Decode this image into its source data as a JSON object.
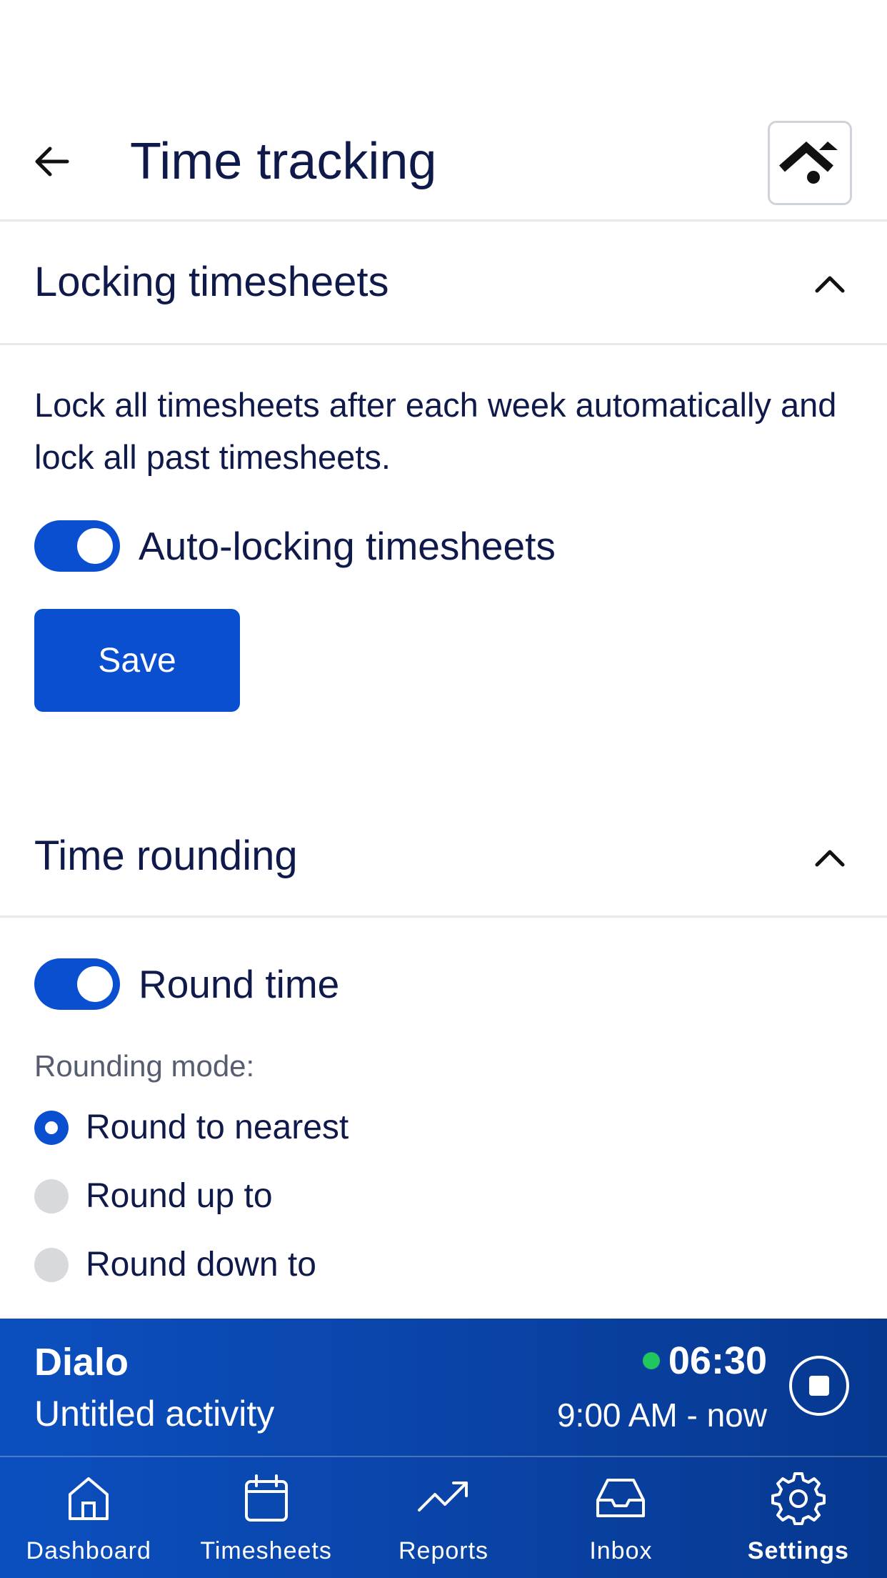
{
  "header": {
    "title": "Time tracking",
    "back_icon": "arrow-left-icon",
    "logo_icon": "roof-logo-icon"
  },
  "locking": {
    "title": "Locking timesheets",
    "description": "Lock all timesheets after each week automatically and lock all past timesheets.",
    "toggle_label": "Auto-locking timesheets",
    "toggle_on": true,
    "save_label": "Save"
  },
  "rounding": {
    "title": "Time rounding",
    "toggle_label": "Round time",
    "toggle_on": true,
    "mode_label": "Rounding mode:",
    "options": [
      {
        "label": "Round to nearest",
        "selected": true
      },
      {
        "label": "Round up to",
        "selected": false
      },
      {
        "label": "Round down to",
        "selected": false
      }
    ]
  },
  "timer": {
    "client": "Dialo",
    "activity": "Untitled activity",
    "elapsed": "06:30",
    "range": "9:00 AM - now",
    "status_color": "#22c55e"
  },
  "nav": {
    "items": [
      {
        "label": "Dashboard",
        "icon": "home-icon",
        "active": false
      },
      {
        "label": "Timesheets",
        "icon": "calendar-icon",
        "active": false
      },
      {
        "label": "Reports",
        "icon": "trend-icon",
        "active": false
      },
      {
        "label": "Inbox",
        "icon": "inbox-icon",
        "active": false
      },
      {
        "label": "Settings",
        "icon": "gear-icon",
        "active": true
      }
    ]
  },
  "colors": {
    "accent": "#0b4fd1",
    "text": "#0f1a4a",
    "bar": "#0a44a8"
  }
}
